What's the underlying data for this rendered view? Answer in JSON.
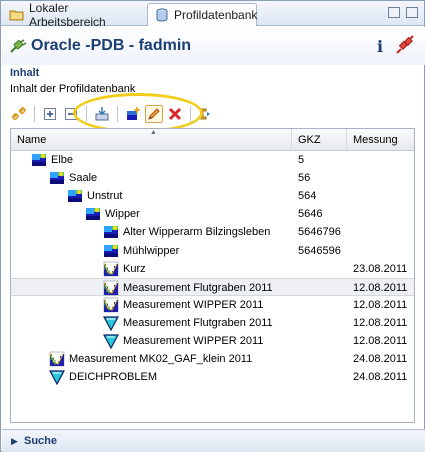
{
  "tabs": [
    {
      "label": "Lokaler Arbeitsbereich",
      "active": false
    },
    {
      "label": "Profildatenbank",
      "active": true
    }
  ],
  "header": {
    "title": "Oracle -PDB - fadmin",
    "info_label": "i"
  },
  "section": {
    "title": "Inhalt",
    "description": "Inhalt der Profildatenbank"
  },
  "toolbar": {
    "icons": [
      "link-icon",
      "expand-all-icon",
      "collapse-all-icon",
      "import-icon",
      "new-item-icon",
      "edit-icon",
      "delete-icon",
      "refresh-icon"
    ]
  },
  "table": {
    "columns": [
      "Name",
      "GKZ",
      "Messung"
    ],
    "rows": [
      {
        "name": "Elbe",
        "gkz": "5",
        "messung": "",
        "level": 1,
        "icon": "waterbody-icon"
      },
      {
        "name": "Saale",
        "gkz": "56",
        "messung": "",
        "level": 2,
        "icon": "waterbody-icon"
      },
      {
        "name": "Unstrut",
        "gkz": "564",
        "messung": "",
        "level": 3,
        "icon": "waterbody-icon"
      },
      {
        "name": "Wipper",
        "gkz": "5646",
        "messung": "",
        "level": 4,
        "icon": "waterbody-icon"
      },
      {
        "name": "Alter Wipperarm Bilzingsleben",
        "gkz": "5646796",
        "messung": "",
        "level": 5,
        "icon": "waterbody-icon"
      },
      {
        "name": "Mühlwipper",
        "gkz": "5646596",
        "messung": "",
        "level": 5,
        "icon": "waterbody-icon"
      },
      {
        "name": "Kurz",
        "gkz": "",
        "messung": "23.08.2011",
        "level": 5,
        "icon": "profile-measurement-icon"
      },
      {
        "name": "Measurement Flutgraben 2011",
        "gkz": "",
        "messung": "12.08.2011",
        "level": 5,
        "icon": "profile-measurement-icon",
        "selected": true
      },
      {
        "name": "Measurement WIPPER 2011",
        "gkz": "",
        "messung": "12.08.2011",
        "level": 5,
        "icon": "profile-measurement-icon"
      },
      {
        "name": "Measurement Flutgraben 2011",
        "gkz": "",
        "messung": "12.08.2011",
        "level": 5,
        "icon": "water-level-icon"
      },
      {
        "name": "Measurement WIPPER 2011",
        "gkz": "",
        "messung": "12.08.2011",
        "level": 5,
        "icon": "water-level-icon"
      },
      {
        "name": "Measurement MK02_GAF_klein 2011",
        "gkz": "",
        "messung": "24.08.2011",
        "level": 2,
        "icon": "profile-measurement-icon"
      },
      {
        "name": "DEICHPROBLEM",
        "gkz": "",
        "messung": "24.08.2011",
        "level": 2,
        "icon": "water-level-icon"
      }
    ]
  },
  "footer": {
    "label": "Suche"
  },
  "colors": {
    "title_blue": "#1c3f74",
    "highlight_ring": "#f2cd1c",
    "delete_red": "#d9262e"
  }
}
